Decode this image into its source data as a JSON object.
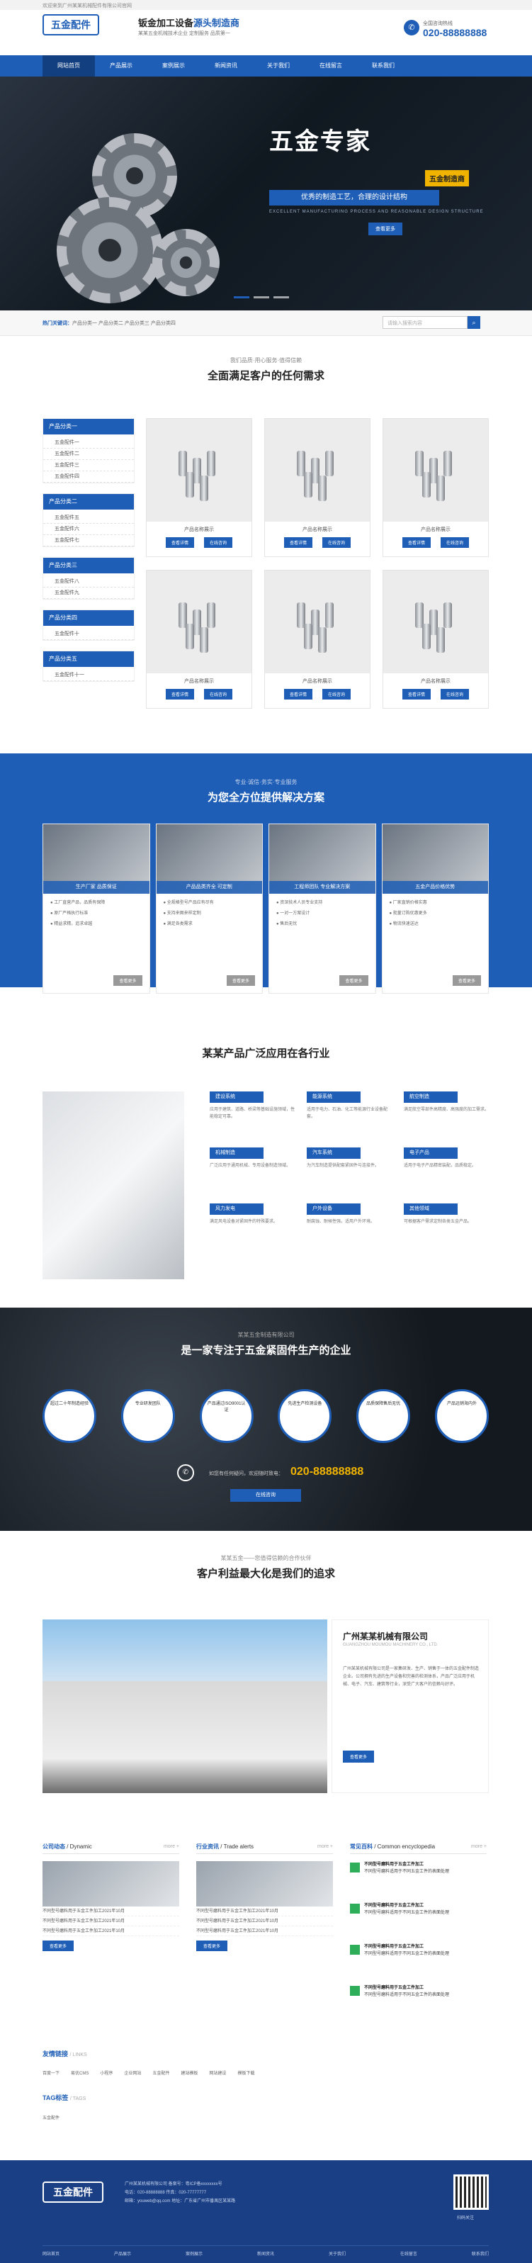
{
  "topbar": {
    "text": "欢迎来到广州某某机械配件有限公司官网"
  },
  "header": {
    "logo": "五金配件",
    "slogan_main": "钣金加工设备",
    "slogan_highlight": "源头制造商",
    "slogan_sub": "某某五金机械技术企业 定制服务 品质第一",
    "phone_label": "全国咨询热线",
    "phone": "020-88888888"
  },
  "nav": [
    "网站首页",
    "产品展示",
    "案例展示",
    "新闻资讯",
    "关于我们",
    "在线留言",
    "联系我们"
  ],
  "banner": {
    "title": "五金专家",
    "tag": "五金制造商",
    "strip": "优秀的制造工艺，合理的设计结构",
    "sub": "EXCELLENT MANUFACTURING PROCESS AND REASONABLE DESIGN STRUCTURE",
    "button": "查看更多"
  },
  "breadcrumb": {
    "label": "热门关键词：",
    "items": "产品分类一  产品分类二  产品分类三  产品分类四"
  },
  "search": {
    "placeholder": "请输入搜索内容",
    "icon": "search-icon"
  },
  "products": {
    "subtitle": "我们品质·用心服务·值得信赖",
    "title": "全面满足客户的任何需求",
    "categories": [
      {
        "name": "产品分类一",
        "items": [
          "五金配件一",
          "五金配件二",
          "五金配件三",
          "五金配件四"
        ]
      },
      {
        "name": "产品分类二",
        "items": [
          "五金配件五",
          "五金配件六",
          "五金配件七"
        ]
      },
      {
        "name": "产品分类三",
        "items": [
          "五金配件八",
          "五金配件九"
        ]
      },
      {
        "name": "产品分类四",
        "items": [
          "五金配件十"
        ]
      },
      {
        "name": "产品分类五",
        "items": [
          "五金配件十一"
        ]
      }
    ],
    "items": [
      {
        "name": "产品名称展示"
      },
      {
        "name": "产品名称展示"
      },
      {
        "name": "产品名称展示"
      },
      {
        "name": "产品名称展示"
      },
      {
        "name": "产品名称展示"
      },
      {
        "name": "产品名称展示"
      }
    ],
    "btn_detail": "查看详情",
    "btn_consult": "在线咨询"
  },
  "solutions": {
    "subtitle": "专业·诚信·务实·专业服务",
    "title": "为您全方位提供解决方案",
    "cards": [
      {
        "caption": "生产厂家 品质保证",
        "lines": [
          "工厂直营产品，品质有保障",
          "原厂严格执行标准",
          "精益求精，追求卓越"
        ]
      },
      {
        "caption": "产品品类齐全 可定制",
        "lines": [
          "全规格型号产品应有尽有",
          "支持来图来样定制",
          "满足各类需求"
        ]
      },
      {
        "caption": "工程师团队 专业解决方案",
        "lines": [
          "资深技术人员专业支持",
          "一对一方案设计",
          "售后无忧"
        ]
      },
      {
        "caption": "五金产品价格优势",
        "lines": [
          "厂家直销价格实惠",
          "批量订购优惠更多",
          "物流快速送达"
        ]
      }
    ],
    "more": "查看更多"
  },
  "industry": {
    "title": "某某产品广泛应用在各行业",
    "items": [
      {
        "name": "建设系统",
        "text": "应用于建筑、道路、桥梁等基础设施领域，性能稳定可靠。"
      },
      {
        "name": "能源系统",
        "text": "适用于电力、石油、化工等能源行业设备配套。"
      },
      {
        "name": "航空制造",
        "text": "满足航空零部件高精度、高强度的加工需求。"
      },
      {
        "name": "机械制造",
        "text": "广泛应用于通用机械、专用设备制造领域。"
      },
      {
        "name": "汽车系统",
        "text": "为汽车制造提供配套紧固件与连接件。"
      },
      {
        "name": "电子产品",
        "text": "适用于电子产品精密装配，品质稳定。"
      },
      {
        "name": "风力发电",
        "text": "满足风电设备对紧固件的特殊要求。"
      },
      {
        "name": "户外设备",
        "text": "耐腐蚀、耐候性强，适用户外环境。"
      },
      {
        "name": "其他领域",
        "text": "可根据客户需求定制各类五金产品。"
      }
    ]
  },
  "enterprise": {
    "subtitle": "某某五金制造有限公司",
    "title": "是一家专注于五金紧固件生产的企业",
    "circles": [
      "超过二十年制造经验",
      "专业研发团队",
      "产品通过ISO9001认证",
      "先进生产检测设备",
      "品质保障售后无忧",
      "产品远销海内外"
    ],
    "phone_label": "如您有任何疑问，欢迎随时致电：",
    "phone": "020-88888888",
    "button": "在线咨询"
  },
  "about": {
    "subtitle": "某某五金——您值得信赖的合作伙伴",
    "title": "客户利益最大化是我们的追求",
    "company": "广州某某机械有限公司",
    "english": "GUANGZHOU MOUMOU MACHINERY CO., LTD.",
    "text": "广州某某机械有限公司是一家集研发、生产、销售于一体的五金配件制造企业。公司拥有先进的生产设备和完善的检测体系，产品广泛应用于机械、电子、汽车、建筑等行业，深受广大客户的信赖与好评。",
    "button": "查看更多"
  },
  "news": {
    "columns": [
      {
        "title": "公司动态",
        "en": "/ Dynamic",
        "items": [
          "不同型号磨料用于五金工件加工2021年10月",
          "不同型号磨料用于五金工件加工2021年10月",
          "不同型号磨料用于五金工件加工2021年10月"
        ]
      },
      {
        "title": "行业资讯",
        "en": "/ Trade alerts",
        "items": [
          "不同型号磨料用于五金工件加工2021年10月",
          "不同型号磨料用于五金工件加工2021年10月",
          "不同型号磨料用于五金工件加工2021年10月"
        ]
      }
    ],
    "encyclopedia": {
      "title": "常见百科",
      "en": "/ Common encyclopedia",
      "items": [
        {
          "t": "不同型号磨料用于五金工件加工",
          "d": "不同型号磨料适用于不同五金工件的表面处理"
        },
        {
          "t": "不同型号磨料用于五金工件加工",
          "d": "不同型号磨料适用于不同五金工件的表面处理"
        },
        {
          "t": "不同型号磨料用于五金工件加工",
          "d": "不同型号磨料适用于不同五金工件的表面处理"
        },
        {
          "t": "不同型号磨料用于五金工件加工",
          "d": "不同型号磨料适用于不同五金工件的表面处理"
        }
      ]
    },
    "more": "more +",
    "button": "查看更多"
  },
  "links": {
    "title": "友情链接",
    "en": "/ LINKS",
    "items": [
      "百度一下",
      "易优CMS",
      "小程序",
      "企业网站",
      "五金配件",
      "建站模板",
      "网站建设",
      "模板下载"
    ]
  },
  "tags": {
    "title": "TAG标签",
    "en": "/ TAGS",
    "items": "五金配件"
  },
  "footer": {
    "logo": "五金配件",
    "lines": [
      "广州某某机械有限公司 备案号：粤ICP备xxxxxxxx号",
      "电话：020-88888888 传真：020-77777777",
      "邮箱：youweb@qq.com 地址：广东省广州市番禺区某某路"
    ],
    "qr_label": "扫码关注",
    "nav": [
      "网站首页",
      "产品展示",
      "案例展示",
      "新闻资讯",
      "关于我们",
      "在线留言",
      "联系我们"
    ]
  }
}
